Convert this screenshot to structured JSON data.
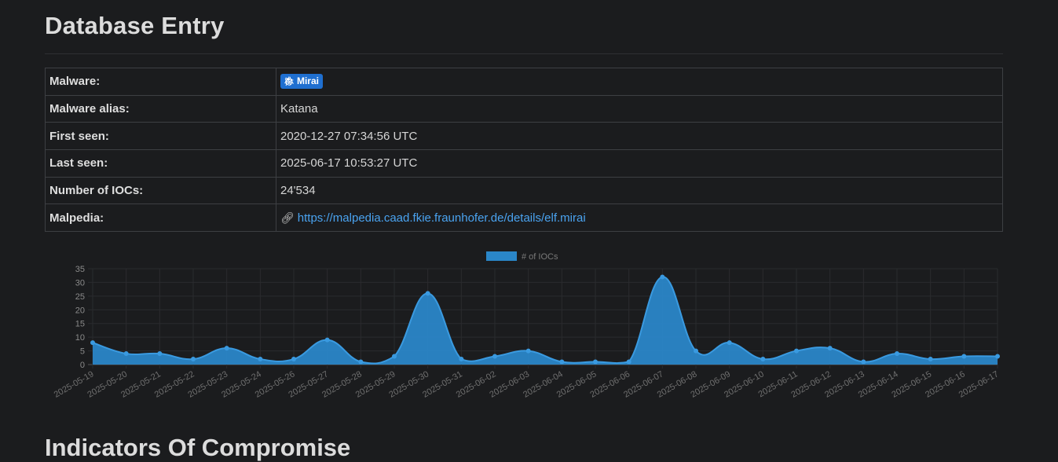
{
  "page": {
    "title": "Database Entry",
    "next_section_title": "Indicators Of Compromise"
  },
  "entry": {
    "malware_label": "Malware:",
    "malware_badge": "Mirai",
    "malware_badge_icon": "bug-icon",
    "alias_label": "Malware alias:",
    "alias_value": "Katana",
    "first_seen_label": "First seen:",
    "first_seen_value": "2020-12-27 07:34:56 UTC",
    "last_seen_label": "Last seen:",
    "last_seen_value": "2025-06-17 10:53:27 UTC",
    "iocs_label": "Number of IOCs:",
    "iocs_value": "24'534",
    "malpedia_label": "Malpedia:",
    "malpedia_icon": "link-icon",
    "malpedia_url": "https://malpedia.caad.fkie.fraunhofer.de/details/elf.mirai"
  },
  "colors": {
    "accent": "#1f6fd0",
    "link": "#4aa3f0",
    "series_fill": "#2a86c8",
    "series_line": "#3a9ae0"
  },
  "chart_data": {
    "type": "area",
    "legend": [
      "# of IOCs"
    ],
    "legend_position": "top-center",
    "ylim": [
      0,
      35
    ],
    "yticks": [
      0,
      5,
      10,
      15,
      20,
      25,
      30,
      35
    ],
    "grid": true,
    "x": [
      "2025-05-19",
      "2025-05-20",
      "2025-05-21",
      "2025-05-22",
      "2025-05-23",
      "2025-05-24",
      "2025-05-26",
      "2025-05-27",
      "2025-05-28",
      "2025-05-29",
      "2025-05-30",
      "2025-05-31",
      "2025-06-02",
      "2025-06-03",
      "2025-06-04",
      "2025-06-05",
      "2025-06-06",
      "2025-06-07",
      "2025-06-08",
      "2025-06-09",
      "2025-06-10",
      "2025-06-11",
      "2025-06-12",
      "2025-06-13",
      "2025-06-14",
      "2025-06-15",
      "2025-06-16",
      "2025-06-17"
    ],
    "series": [
      {
        "name": "# of IOCs",
        "values": [
          8,
          4,
          4,
          2,
          6,
          2,
          2,
          9,
          1,
          3,
          26,
          2,
          3,
          5,
          1,
          1,
          1,
          32,
          5,
          8,
          2,
          5,
          6,
          1,
          4,
          2,
          3,
          3
        ]
      }
    ]
  }
}
